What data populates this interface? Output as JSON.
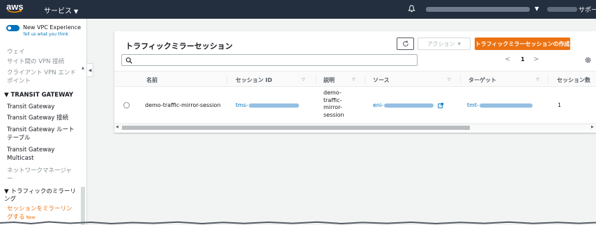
{
  "topbar": {
    "logo": "aws",
    "services_label": "サービス",
    "support_label": "サポート"
  },
  "sidebar": {
    "vpc_experience_title": "New VPC Experience",
    "vpc_experience_link": "Tell us what you think",
    "items_top": [
      "ウェイ",
      "サイト間の VPN 接続",
      "クライアント VPN エンドポイント"
    ],
    "transit_section": "TRANSIT GATEWAY",
    "transit_items": [
      "Transit Gateway",
      "Transit Gateway 接続",
      "Transit Gateway ルートテーブル",
      "Transit Gateway Multicast",
      "ネットワークマネージャー"
    ],
    "mirroring_section": "トラフィックのミラーリング",
    "active_item": "セッションをミラーリングする",
    "new_badge": "New"
  },
  "panel": {
    "title": "トラフィックミラーセッション",
    "actions_label": "アクション",
    "create_label": "トラフィックミラーセッションの作成",
    "search_placeholder": "",
    "page_number": "1"
  },
  "table": {
    "columns": [
      "名前",
      "セッション ID",
      "説明",
      "ソース",
      "ターゲット",
      "セッション数"
    ],
    "rows": [
      {
        "name": "demo-traffic-mirror-session",
        "session_id_prefix": "tms-",
        "description": "demo-traffic-mirror-session",
        "source_prefix": "eni-",
        "target_prefix": "tmt-",
        "session_number": "1"
      }
    ]
  },
  "colors": {
    "topbar": "#232f3e",
    "accent_orange": "#ec7211",
    "link_blue": "#0073bb"
  }
}
